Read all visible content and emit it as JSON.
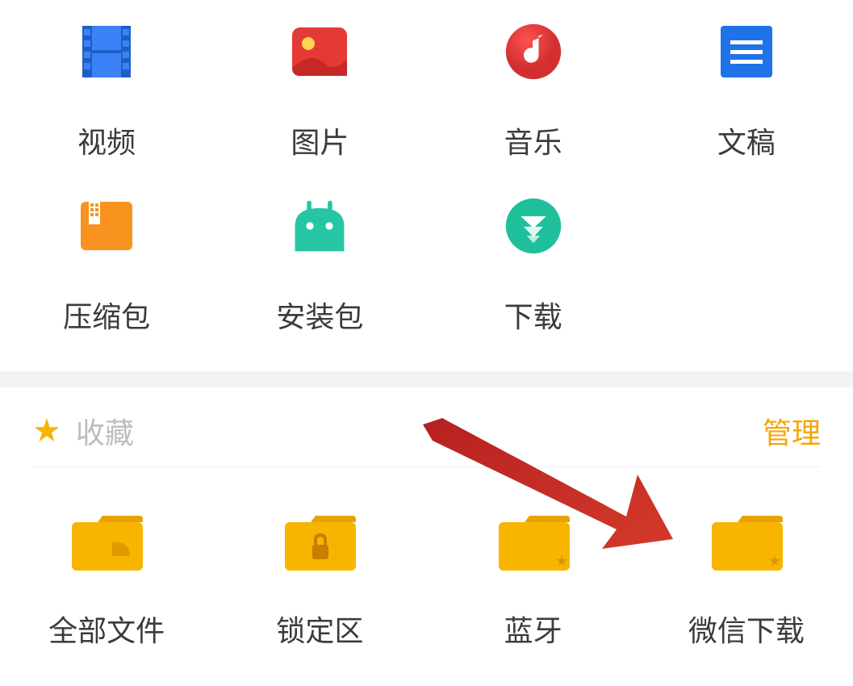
{
  "categories": [
    {
      "label": "视频",
      "icon": "video-icon"
    },
    {
      "label": "图片",
      "icon": "picture-icon"
    },
    {
      "label": "音乐",
      "icon": "music-icon"
    },
    {
      "label": "文稿",
      "icon": "document-icon"
    },
    {
      "label": "压缩包",
      "icon": "archive-icon"
    },
    {
      "label": "安装包",
      "icon": "apk-icon"
    },
    {
      "label": "下载",
      "icon": "download-icon"
    }
  ],
  "favorites": {
    "title": "收藏",
    "manage": "管理",
    "folders": [
      {
        "label": "全部文件",
        "icon": "folder-all-icon"
      },
      {
        "label": "锁定区",
        "icon": "folder-lock-icon"
      },
      {
        "label": "蓝牙",
        "icon": "folder-star-icon"
      },
      {
        "label": "微信下载",
        "icon": "folder-star-icon"
      }
    ]
  },
  "annotation": {
    "arrow_color": "#c0392b"
  }
}
